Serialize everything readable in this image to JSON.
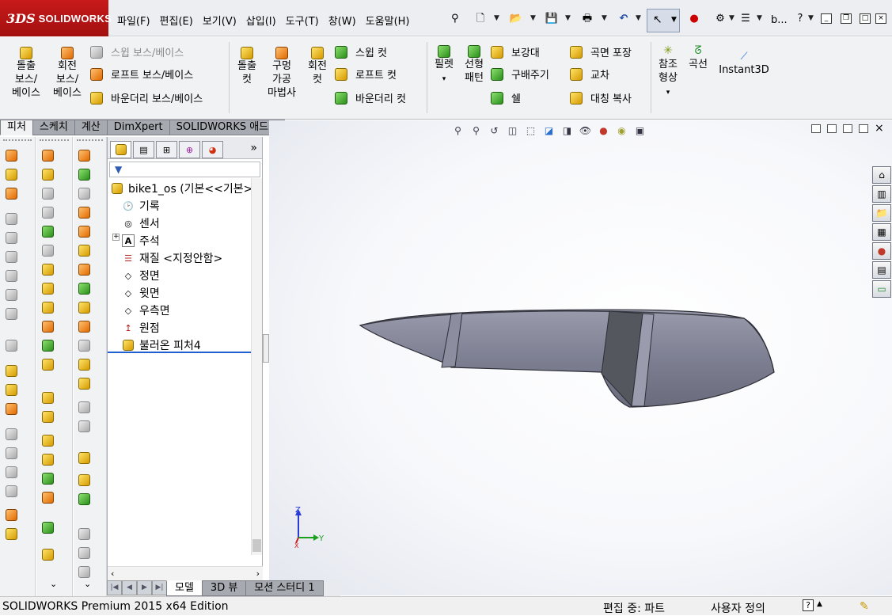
{
  "app": {
    "logo_prefix": "3DS",
    "logo_name": "SOLIDWORKS",
    "doc_tab": "b..."
  },
  "menu": [
    "파일(F)",
    "편집(E)",
    "보기(V)",
    "삽입(I)",
    "도구(T)",
    "창(W)",
    "도움말(H)"
  ],
  "toolbar_icons": [
    "search-icon",
    "new-document-icon",
    "open-folder-icon",
    "save-icon",
    "print-icon",
    "undo-icon",
    "select-pointer-icon",
    "traffic-light-icon",
    "options-icon",
    "file-properties-icon",
    "help-icon"
  ],
  "features": {
    "extrude_boss": "돌출\n보스/\n베이스",
    "revolve_boss": "회전\n보스/\n베이스",
    "swept_boss": "스윕 보스/베이스",
    "loft_boss": "로프트 보스/베이스",
    "boundary_boss": "바운더리 보스/베이스",
    "extruded_cut": "돌출\n컷",
    "hole_wizard": "구멍\n가공\n마법사",
    "revolved_cut": "회전\n컷",
    "swept_cut": "스윕 컷",
    "lofted_cut": "로프트 컷",
    "boundary_cut": "바운더리 컷",
    "fillet": "필렛",
    "linear_pattern": "선형\n패턴",
    "rib": "보강대",
    "draft": "구배주기",
    "shell": "쉘",
    "wrap": "곡면 포장",
    "intersect": "교차",
    "mirror": "대칭 복사",
    "reference_geometry": "참조\n형상",
    "curves": "곡선",
    "instant3d": "Instant3D"
  },
  "cmd_tabs": [
    "피처",
    "스케치",
    "계산",
    "DimXpert",
    "SOLIDWORKS 애드인"
  ],
  "feature_tree": {
    "root": "bike1_os  (기본<<기본>",
    "items": [
      "기록",
      "센서",
      "주석",
      "재질 <지정안함>",
      "정면",
      "윗면",
      "우측면",
      "원점",
      "불러온 피처4"
    ]
  },
  "bottom_tabs": [
    "모델",
    "3D 뷰",
    "모션 스터디 1"
  ],
  "status": {
    "edition": "SOLIDWORKS Premium 2015 x64 Edition",
    "editing": "편집 중: 파트",
    "units": "사용자 정의"
  },
  "triad": {
    "z": "Z",
    "y": "Y",
    "x": "X"
  },
  "colors": {
    "model_fill": "#7f8194",
    "model_dark": "#55575f",
    "accent_red": "#b01616"
  }
}
